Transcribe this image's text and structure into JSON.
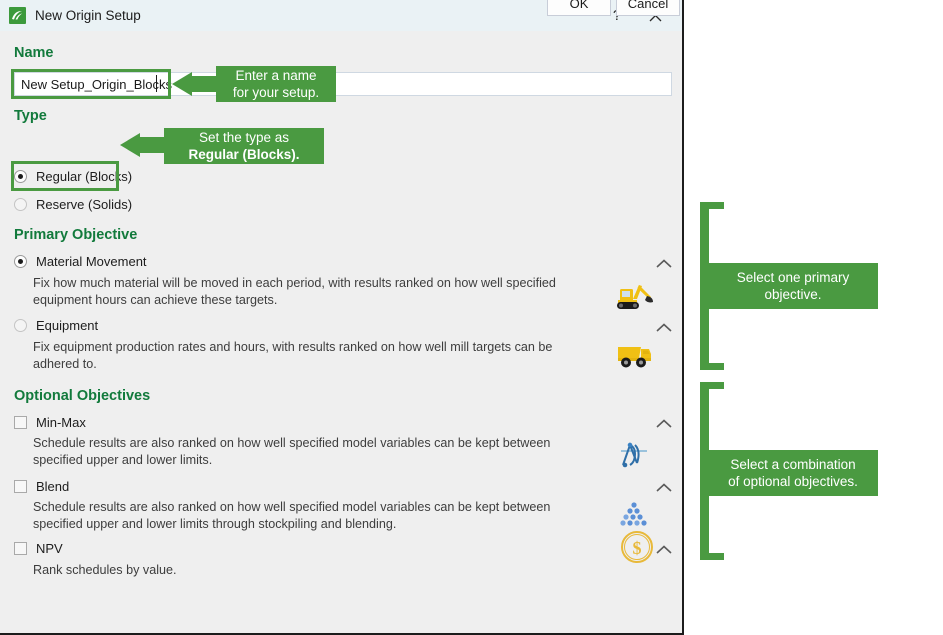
{
  "window": {
    "title": "New Origin Setup",
    "icon": "app-logo-icon",
    "help_label": "?",
    "close_label": "✕"
  },
  "name_section": {
    "heading": "Name",
    "value": "New Setup_Origin_Blocks",
    "placeholder": "",
    "callout": "Enter a name\nfor your setup."
  },
  "type_section": {
    "heading": "Type",
    "options": [
      {
        "label": "Regular (Blocks)",
        "selected": true
      },
      {
        "label": "Reserve (Solids)",
        "selected": false
      }
    ],
    "callout_line1": "Set the type as",
    "callout_line2": "Regular (Blocks)."
  },
  "primary_objective": {
    "heading": "Primary Objective",
    "callout": "Select one primary\nobjective.",
    "items": [
      {
        "label": "Material Movement",
        "selected": true,
        "description": "Fix how much material will be moved in each period, with results ranked on how well specified equipment hours can achieve these targets.",
        "icon": "excavator-icon",
        "chevron": "chevron-up-icon"
      },
      {
        "label": "Equipment",
        "selected": false,
        "description": "Fix equipment production rates and hours, with results ranked on how well mill targets can be adhered to.",
        "icon": "dump-truck-icon",
        "chevron": "chevron-up-icon"
      }
    ]
  },
  "optional_objectives": {
    "heading": "Optional Objectives",
    "callout": "Select a combination\nof optional objectives.",
    "items": [
      {
        "label": "Min-Max",
        "checked": false,
        "description": "Schedule results are also ranked on how well specified model variables can be kept between specified upper and lower limits.",
        "icon": "sine-wave-icon",
        "chevron": "chevron-up-icon"
      },
      {
        "label": "Blend",
        "checked": false,
        "description": "Schedule results are also ranked on how well specified model variables can be kept between specified upper and lower limits through stockpiling and blending.",
        "icon": "blend-dots-icon",
        "chevron": "chevron-up-icon"
      },
      {
        "label": "NPV",
        "checked": false,
        "description": "Rank schedules by value.",
        "icon": "dollar-coin-icon",
        "chevron": "chevron-up-icon"
      }
    ]
  },
  "footer": {
    "ok_label": "OK",
    "cancel_label": "Cancel"
  },
  "colors": {
    "accent_green": "#4a9a41",
    "heading_green": "#127a3c",
    "titlebar": "#eaf2f5",
    "dialog_bg": "#efefef"
  }
}
